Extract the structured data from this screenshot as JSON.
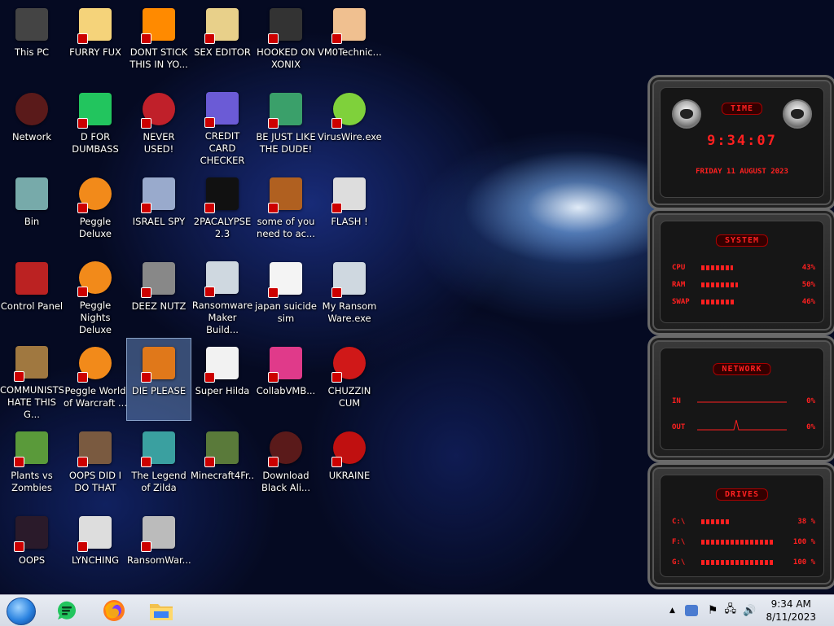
{
  "desktop_icons": [
    {
      "label": "This PC",
      "icon": "computer-icon"
    },
    {
      "label": "FURRY FUX",
      "icon": "cartoon-icon"
    },
    {
      "label": "DONT STICK THIS IN YO...",
      "icon": "vlc-cone-icon"
    },
    {
      "label": "SEX EDITOR",
      "icon": "hxd-editor-icon"
    },
    {
      "label": "HOOKED ON XONIX",
      "icon": "game-icon"
    },
    {
      "label": "VM0Technic...",
      "icon": "doctor-icon"
    },
    {
      "label": "Network",
      "icon": "alien-icon"
    },
    {
      "label": "D FOR DUMBASS",
      "icon": "green-chat-icon"
    },
    {
      "label": "NEVER USED!",
      "icon": "dev-cpp-icon"
    },
    {
      "label": "CREDIT CARD CHECKER",
      "icon": "card-icon"
    },
    {
      "label": "BE JUST LIKE THE DUDE!",
      "icon": "santa-icon"
    },
    {
      "label": "VirusWire.exe",
      "icon": "lime-icon"
    },
    {
      "label": "Bin",
      "icon": "recycle-bin-icon"
    },
    {
      "label": "Peggle Deluxe",
      "icon": "peggle-icon"
    },
    {
      "label": "ISRAEL SPY",
      "icon": "network-spy-icon"
    },
    {
      "label": "2PACALYPSE 2.3",
      "icon": "terminal-icon"
    },
    {
      "label": "some of you need to ac...",
      "icon": "bear-icon"
    },
    {
      "label": "FLASH !",
      "icon": "flash-icon"
    },
    {
      "label": "Control Panel",
      "icon": "control-panel-icon"
    },
    {
      "label": "Peggle Nights Deluxe",
      "icon": "peggle-icon"
    },
    {
      "label": "DEEZ NUTZ",
      "icon": "windows-stack-icon"
    },
    {
      "label": "Ransomware Maker Build...",
      "icon": "window-app-icon"
    },
    {
      "label": "japan suicide sim",
      "icon": "document-icon"
    },
    {
      "label": "My Ransom Ware.exe",
      "icon": "window-app-icon"
    },
    {
      "label": "COMMUNISTS HATE THIS G...",
      "icon": "money-bag-icon"
    },
    {
      "label": "Peggle World of Warcraft ...",
      "icon": "peggle-icon"
    },
    {
      "label": "DIE PLEASE",
      "icon": "de-icon"
    },
    {
      "label": "Super Hilda",
      "icon": "pixel-char-icon"
    },
    {
      "label": "CollabVMB...",
      "icon": "collab-icon"
    },
    {
      "label": "CHUZZIN CUM",
      "icon": "chuzzle-icon"
    },
    {
      "label": "Plants vs Zombies",
      "icon": "flower-icon"
    },
    {
      "label": "OOPS DID I DO THAT",
      "icon": "portrait-icon"
    },
    {
      "label": "The Legend of Zilda",
      "icon": "pixel-link-icon"
    },
    {
      "label": "Minecraft4Fr...",
      "icon": "grass-block-icon"
    },
    {
      "label": "Download Black Ali...",
      "icon": "alien-icon"
    },
    {
      "label": "UKRAINE",
      "icon": "radiation-icon"
    },
    {
      "label": "OOPS",
      "icon": "dark-app-icon"
    },
    {
      "label": "LYNCHING",
      "icon": "zip-icon"
    },
    {
      "label": "RansomWar...",
      "icon": "skull-icon"
    }
  ],
  "time_gadget": {
    "title": "TIME",
    "time": "9:34:07",
    "date": "FRIDAY 11 AUGUST 2023"
  },
  "system_gadget": {
    "title": "SYSTEM",
    "rows": [
      {
        "label": "CPU",
        "value": "43%",
        "fraction": 0.43
      },
      {
        "label": "RAM",
        "value": "50%",
        "fraction": 0.5
      },
      {
        "label": "SWAP",
        "value": "46%",
        "fraction": 0.46
      }
    ]
  },
  "network_gadget": {
    "title": "NETWORK",
    "rows": [
      {
        "label": "IN",
        "value": "0%"
      },
      {
        "label": "OUT",
        "value": "0%"
      }
    ]
  },
  "drives_gadget": {
    "title": "DRIVES",
    "rows": [
      {
        "label": "C:\\",
        "value": "38 %",
        "fraction": 0.38
      },
      {
        "label": "F:\\",
        "value": "100 %",
        "fraction": 1.0
      },
      {
        "label": "G:\\",
        "value": "100 %",
        "fraction": 1.0
      }
    ]
  },
  "taskbar": {
    "pinned": [
      "green-chat-icon",
      "firefox-icon",
      "file-explorer-icon"
    ],
    "clock_time": "9:34 AM",
    "clock_date": "8/11/2023"
  },
  "colors": {
    "gadget_accent": "#ff2020",
    "taskbar_bg": "#dde2ea"
  }
}
